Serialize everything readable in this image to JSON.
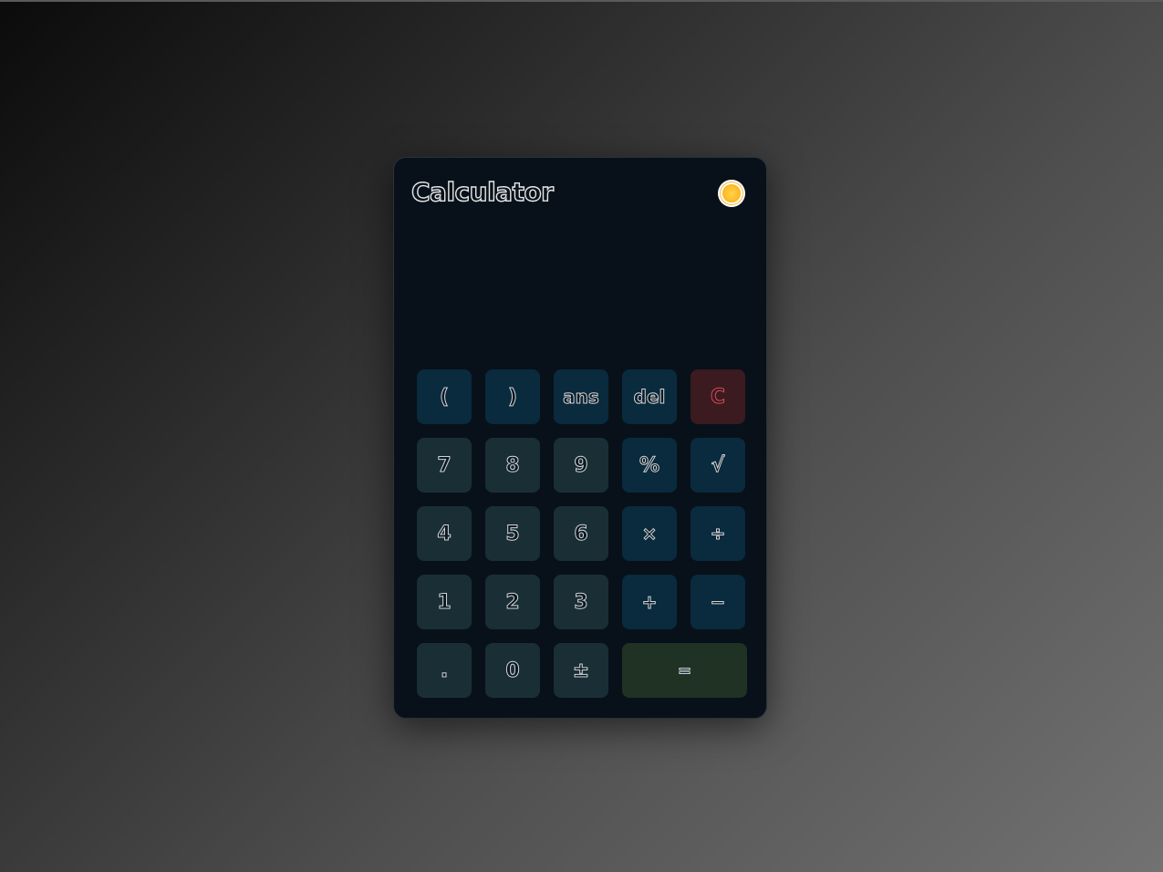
{
  "header": {
    "title": "Calculator",
    "theme_icon": "sun-icon"
  },
  "display": {
    "expression": "",
    "result": ""
  },
  "keypad": {
    "row1": [
      "(",
      ")",
      "ans",
      "del",
      "C"
    ],
    "row2": [
      "7",
      "8",
      "9",
      "%",
      "√"
    ],
    "row3": [
      "4",
      "5",
      "6",
      "×",
      "÷"
    ],
    "row4": [
      "1",
      "2",
      "3",
      "+",
      "−"
    ],
    "row5": [
      ".",
      "0",
      "±",
      "="
    ]
  },
  "colors": {
    "card_bg": "#08111a",
    "number_key": "#1a2e36",
    "operator_key": "#0a2a3e",
    "clear_key": "#3b1a20",
    "clear_text": "#d14b55",
    "equals_key": "#1f3224",
    "text_outline": "#cfd5d9"
  }
}
